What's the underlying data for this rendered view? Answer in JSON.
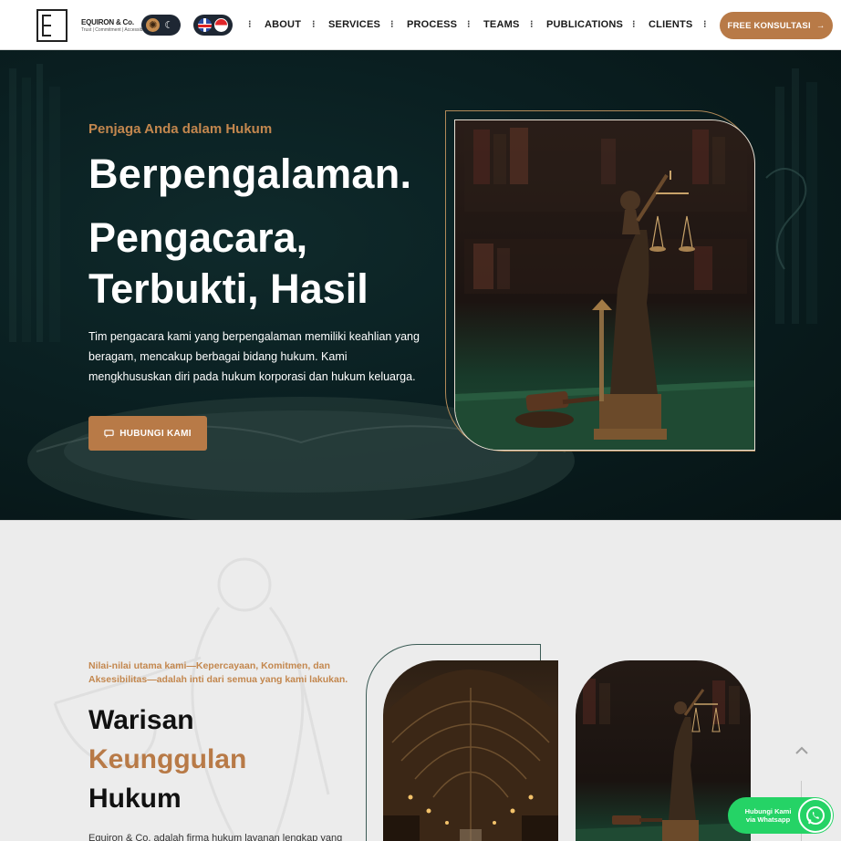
{
  "brand": {
    "name": "EQUIRON & Co.",
    "tagline": "Trust | Commitment | Accessible",
    "logo_letter": "E"
  },
  "toggles": {
    "theme_icons": [
      "sun-icon",
      "moon-icon"
    ],
    "languages": [
      "English",
      "Indonesia"
    ]
  },
  "nav": {
    "items": [
      {
        "label": "ABOUT"
      },
      {
        "label": "SERVICES"
      },
      {
        "label": "PROCESS"
      },
      {
        "label": "TEAMS"
      },
      {
        "label": "PUBLICATIONS"
      },
      {
        "label": "CLIENTS"
      }
    ],
    "separator": "⁝",
    "cta_label": "FREE KONSULTASI",
    "cta_arrow": "→"
  },
  "hero": {
    "eyebrow": "Penjaga Anda dalam Hukum",
    "heading_line1": "Berpengalaman.",
    "heading_line2": "Pengacara,",
    "heading_line3": "Terbukti, Hasil",
    "description": "Tim pengacara kami yang berpengalaman memiliki keahlian yang beragam, mencakup berbagai bidang hukum. Kami mengkhususkan diri pada hukum korporasi dan hukum keluarga.",
    "button_label": "HUBUNGI KAMI"
  },
  "values_section": {
    "eyebrow": "Nilai-nilai utama kami—Kepercayaan, Komitmen, dan Aksesibilitas—adalah inti dari semua yang kami lakukan.",
    "heading_line1": "Warisan",
    "heading_line2": "Keunggulan",
    "heading_line3": "Hukum",
    "body_start": "Equiron & Co. adalah firma hukum layanan lengkap yang"
  },
  "floating": {
    "whatsapp_label_line1": "Hubungi Kami",
    "whatsapp_label_line2": "via Whatsapp"
  },
  "colors": {
    "accent": "#b87a47",
    "hero_bg": "#0a1f21",
    "whatsapp": "#25d366"
  }
}
